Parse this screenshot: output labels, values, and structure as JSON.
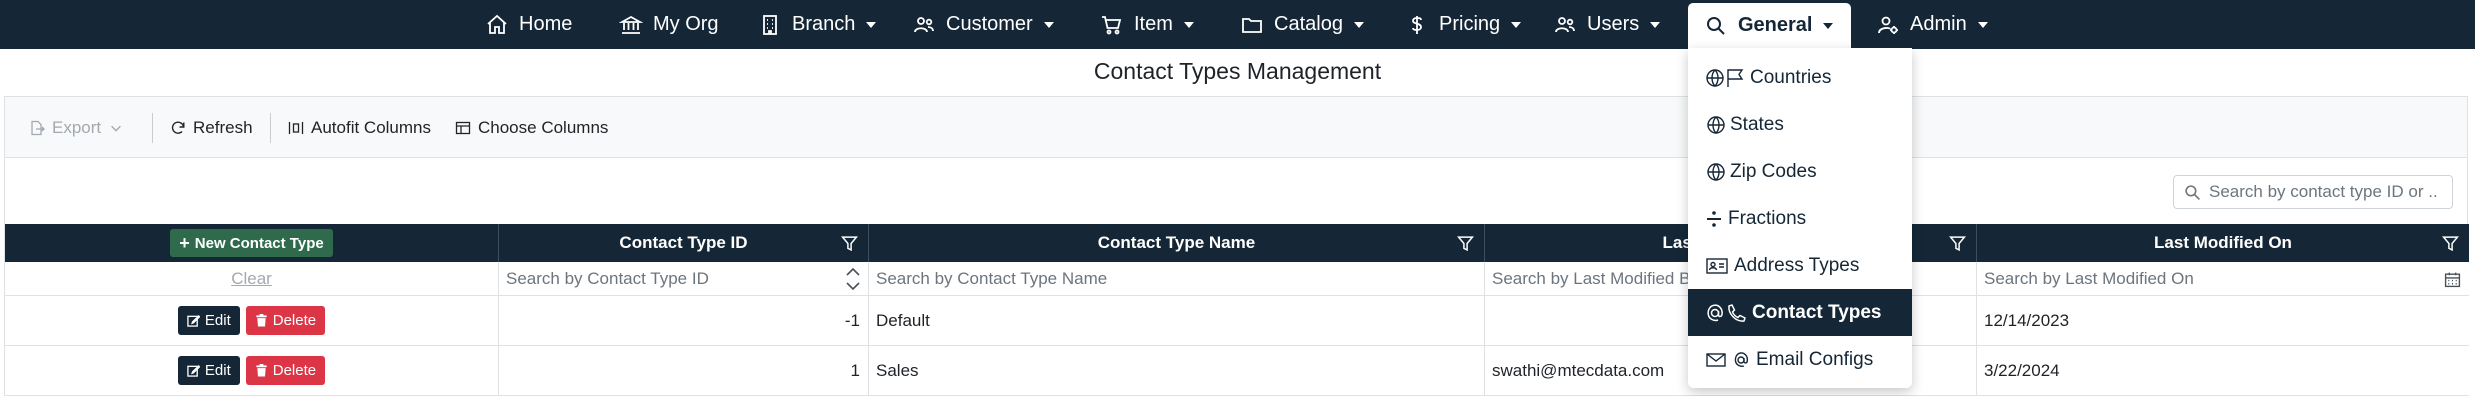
{
  "nav": {
    "items": [
      {
        "label": "Home",
        "icon": "house-icon",
        "caret": false
      },
      {
        "label": "My Org",
        "icon": "bank-icon",
        "caret": false
      },
      {
        "label": "Branch",
        "icon": "building-icon",
        "caret": true
      },
      {
        "label": "Customer",
        "icon": "people-icon",
        "caret": true
      },
      {
        "label": "Item",
        "icon": "cart-icon",
        "caret": true
      },
      {
        "label": "Catalog",
        "icon": "folder-icon",
        "caret": true
      },
      {
        "label": "Pricing",
        "icon": "dollar-icon",
        "caret": true
      },
      {
        "label": "Users",
        "icon": "people-icon",
        "caret": true
      },
      {
        "label": "General",
        "icon": "search-icon",
        "caret": true,
        "active": true
      },
      {
        "label": "Admin",
        "icon": "person-gear-icon",
        "caret": true
      }
    ]
  },
  "dropdown": {
    "items": [
      {
        "label": "Countries",
        "icon": "globe-flag-icon"
      },
      {
        "label": "States",
        "icon": "globe-icon"
      },
      {
        "label": "Zip Codes",
        "icon": "globe-icon"
      },
      {
        "label": "Fractions",
        "icon": "divide-icon"
      },
      {
        "label": "Address Types",
        "icon": "address-card-icon"
      },
      {
        "label": "Contact Types",
        "icon": "at-phone-icon",
        "active": true
      },
      {
        "label": "Email Configs",
        "icon": "envelope-at-icon"
      }
    ]
  },
  "page": {
    "title": "Contact Types Management"
  },
  "toolbar": {
    "export": "Export",
    "refresh": "Refresh",
    "autofit": "Autofit Columns",
    "choose": "Choose Columns"
  },
  "search": {
    "placeholder": "Search by contact type ID or ..."
  },
  "table": {
    "new_button": "New Contact Type",
    "columns": [
      "Contact Type ID",
      "Contact Type Name",
      "Last Modified By",
      "Last Modified On"
    ],
    "filters": {
      "clear": "Clear",
      "placeholders": [
        "Search by Contact Type ID",
        "Search by Contact Type Name",
        "Search by Last Modified By",
        "Search by Last Modified On"
      ]
    },
    "edit_label": "Edit",
    "delete_label": "Delete",
    "rows": [
      {
        "id": "-1",
        "name": "Default",
        "modified_by": "",
        "modified_on": "12/14/2023"
      },
      {
        "id": "1",
        "name": "Sales",
        "modified_by": "swathi@mtecdata.com",
        "modified_on": "3/22/2024"
      }
    ]
  },
  "colors": {
    "navy": "#152736",
    "green": "#2f6a4d",
    "danger": "#dc3545"
  }
}
